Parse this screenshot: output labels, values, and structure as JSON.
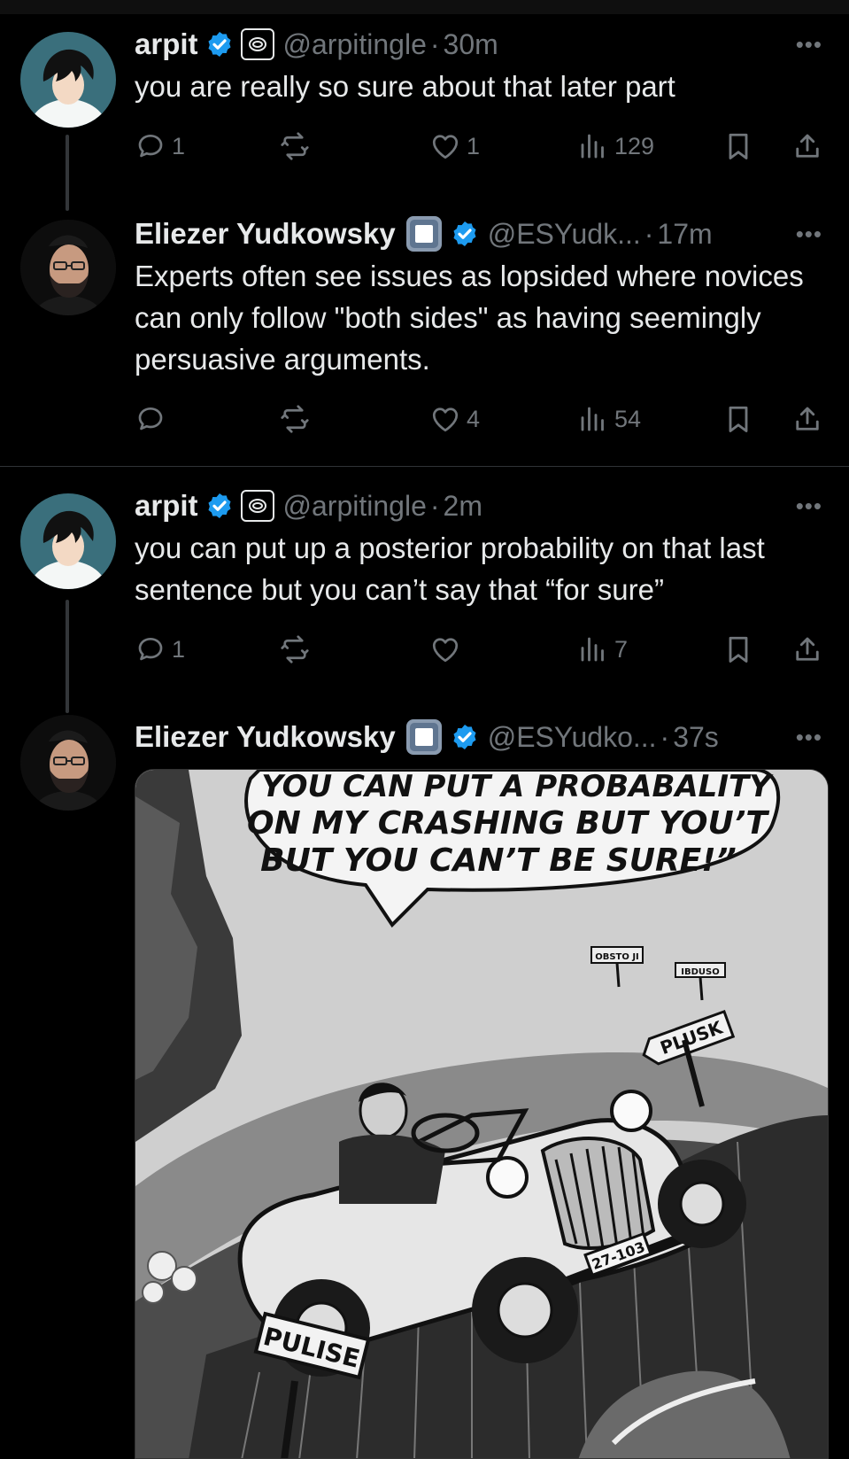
{
  "tweets": [
    {
      "name": "arpit",
      "handle": "@arpitingle",
      "time": "30m",
      "text": "you are really so sure about that later part",
      "replies": "1",
      "reposts": "",
      "likes": "1",
      "views": "129"
    },
    {
      "name": "Eliezer Yudkowsky",
      "handle": "@ESYudk...",
      "time": "17m",
      "text": "Experts often see issues as lopsided where novices can only follow \"both sides\" as having seemingly persuasive arguments.",
      "replies": "",
      "reposts": "",
      "likes": "4",
      "views": "54"
    },
    {
      "name": "arpit",
      "handle": "@arpitingle",
      "time": "2m",
      "text": "you can put up a posterior probability on that last sentence but you can’t say that “for sure”",
      "replies": "1",
      "reposts": "",
      "likes": "",
      "views": "7"
    },
    {
      "name": "Eliezer Yudkowsky",
      "handle": "@ESYudko...",
      "time": "37s",
      "media": {
        "bubble_lines": [
          "YOU CAN PUT A PROBABALITY",
          "ON MY CRASHING BUT YOU’T",
          "BUT YOU CAN’T BE SURE!”"
        ],
        "sign_bottom": "PULISE",
        "sign_right": "PLUSK",
        "plate": "27-103",
        "sign_small_1": "OBSTO JI",
        "sign_small_2": "IBDUSO"
      }
    }
  ],
  "separator": "·",
  "more_glyph": "•••",
  "colors": {
    "background": "#000000",
    "text": "#e7e9ea",
    "muted": "#71767b",
    "verified": "#1d9bf0",
    "divider": "#2f3336"
  },
  "icons": [
    "reply-icon",
    "repost-icon",
    "like-icon",
    "views-icon",
    "bookmark-icon",
    "share-icon",
    "verified-icon",
    "affiliate-badge-icon",
    "square-badge-icon",
    "more-icon"
  ]
}
